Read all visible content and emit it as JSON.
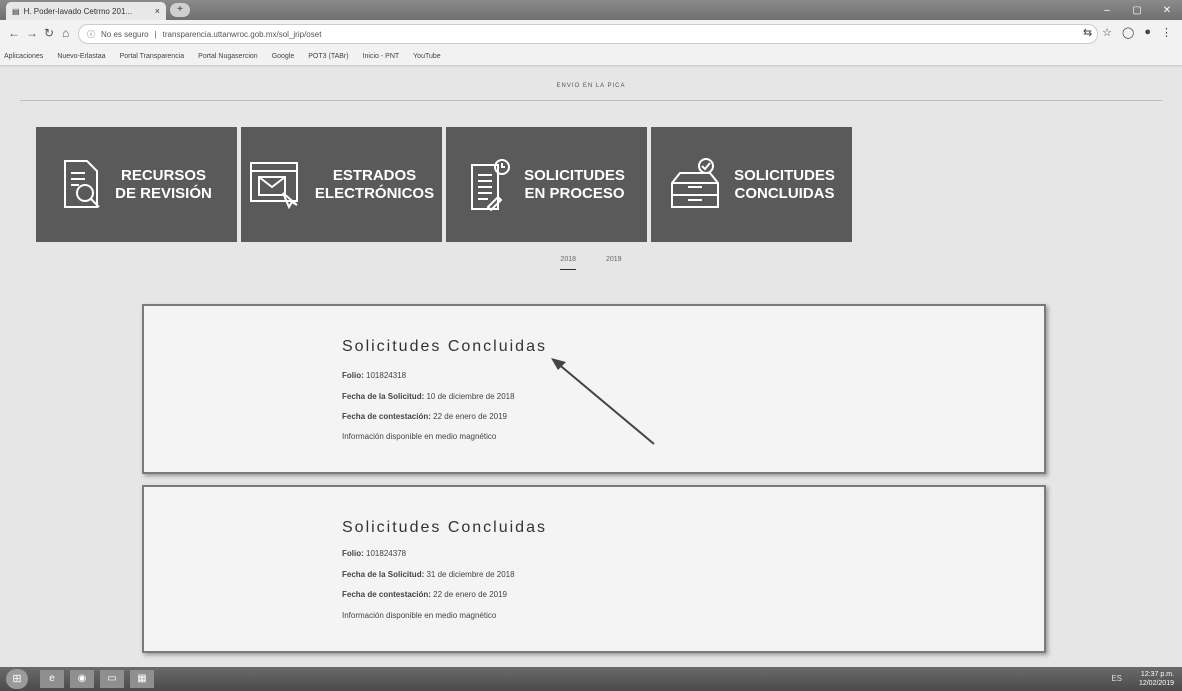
{
  "browser": {
    "tab_title": "H. Poder-lavado Cetrmo 201...",
    "tab_close": "×",
    "new_tab": "+",
    "url_security": "No es seguro",
    "url": "transparencia.uttanwroc.gob.mx/sol_jrip/oset",
    "bookmarks": [
      "Aplicaciones",
      "Nuevo-Erlastaa",
      "Portal Transparencia",
      "Portal Nugasercion",
      "Google",
      "POT3 (TABr)",
      "Inicio - PNT",
      "YouTube"
    ]
  },
  "page": {
    "hint": "ENVIO EN LA PICA",
    "tiles": [
      {
        "label_line1": "RECURSOS",
        "label_line2": "DE REVISIÓN",
        "icon": "document-search-icon"
      },
      {
        "label_line1": "ESTRADOS",
        "label_line2": "ELECTRÓNICOS",
        "icon": "email-window-icon"
      },
      {
        "label_line1": "SOLICITUDES",
        "label_line2": "EN PROCESO",
        "icon": "document-clock-icon"
      },
      {
        "label_line1": "SOLICITUDES",
        "label_line2": "CONCLUIDAS",
        "icon": "archive-box-icon"
      }
    ],
    "years": [
      "2018",
      "2019"
    ],
    "cards": [
      {
        "title": "Solicitudes Concluidas",
        "folio_label": "Folio:",
        "folio_value": "101824318",
        "fecha_sol_label": "Fecha de la Solicitud:",
        "fecha_sol_value": "10 de diciembre de 2018",
        "fecha_con_label": "Fecha de contestación:",
        "fecha_con_value": "22 de enero de 2019",
        "info": "Información disponible en medio magnético"
      },
      {
        "title": "Solicitudes Concluidas",
        "folio_label": "Folio:",
        "folio_value": "101824378",
        "fecha_sol_label": "Fecha de la Solicitud:",
        "fecha_sol_value": "31 de diciembre de 2018",
        "fecha_con_label": "Fecha de contestación:",
        "fecha_con_value": "22 de enero de 2019",
        "info": "Información disponible en medio magnético"
      }
    ]
  },
  "taskbar": {
    "clock_time": "12:37 p.m.",
    "clock_date": "12/02/2019",
    "tray": "ES"
  }
}
